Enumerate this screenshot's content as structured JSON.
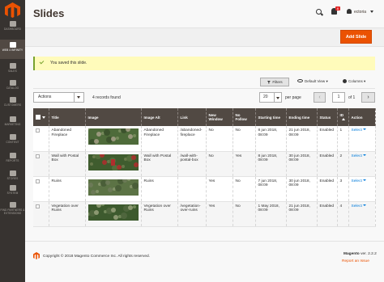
{
  "sidebar": {
    "items": [
      {
        "label": "DASHBOARD",
        "icon": "dashboard-icon"
      },
      {
        "label": "WEB 4 INFINITY",
        "icon": "web4infinity-icon"
      },
      {
        "label": "SALES",
        "icon": "dollar-icon"
      },
      {
        "label": "CATALOG",
        "icon": "box-icon"
      },
      {
        "label": "CUSTOMERS",
        "icon": "person-icon"
      },
      {
        "label": "MARKETING",
        "icon": "megaphone-icon"
      },
      {
        "label": "CONTENT",
        "icon": "layout-icon"
      },
      {
        "label": "REPORTS",
        "icon": "bar-chart-icon"
      },
      {
        "label": "STORES",
        "icon": "store-icon"
      },
      {
        "label": "SYSTEM",
        "icon": "gear-icon"
      },
      {
        "label": "FIND PARTNERS & EXTENSIONS",
        "icon": "puzzle-icon"
      }
    ],
    "active_index": 1
  },
  "header": {
    "title": "Slides",
    "notifications_count": "6",
    "user": "ectoria"
  },
  "actions": {
    "add_label": "Add Slide"
  },
  "message": {
    "text": "You saved this slide."
  },
  "controls": {
    "filters": "Filters",
    "view": "Default View",
    "columns": "Columns",
    "mass_action": "Actions",
    "records": "4 records found",
    "per_page_value": "20",
    "per_page_label": "per page",
    "page_value": "1",
    "page_of": "of 1"
  },
  "table": {
    "headers": [
      "Title",
      "Image",
      "Image Alt",
      "Link",
      "New Window",
      "No Follow",
      "Starting time",
      "Ending time",
      "Status",
      "ID",
      "Action"
    ],
    "rows": [
      {
        "title": "Abandoned Fireplace",
        "image_alt": "Abandoned Fireplace",
        "link": "/abandoned-fireplace",
        "new_window": "No",
        "no_follow": "No",
        "start": "8 jun 2018, 08:09",
        "end": "21 jun 2018, 08:09",
        "status": "Enabled",
        "id": "1",
        "action": "Select"
      },
      {
        "title": "Wall with Postal Box",
        "image_alt": "Wall with Postal Box",
        "link": "/wall-with-postal-box",
        "new_window": "No",
        "no_follow": "Yes",
        "start": "8 jun 2018, 08:09",
        "end": "30 jun 2018, 08:09",
        "status": "Enabled",
        "id": "2",
        "action": "Select"
      },
      {
        "title": "Ruins",
        "image_alt": "Ruins",
        "link": "",
        "new_window": "Yes",
        "no_follow": "No",
        "start": "7 jun 2018, 08:09",
        "end": "30 jun 2018, 08:09",
        "status": "Enabled",
        "id": "3",
        "action": "Select"
      },
      {
        "title": "Vegetation over Ruins",
        "image_alt": "Vegetation over Ruins",
        "link": "/vegetation-over-ruins",
        "new_window": "Yes",
        "no_follow": "No",
        "start": "1 May 2018, 08:09",
        "end": "21 jun 2018, 08:09",
        "status": "Enabled",
        "id": "4",
        "action": "Select"
      }
    ]
  },
  "footer": {
    "copyright": "Copyright © 2018 Magento Commerce Inc. All rights reserved.",
    "brand": "Magento",
    "version": "ver. 2.2.2",
    "report": "Report an Issue"
  },
  "colors": {
    "accent": "#eb5202",
    "sidebar": "#373330",
    "table_header": "#514943",
    "link": "#007bdb"
  }
}
